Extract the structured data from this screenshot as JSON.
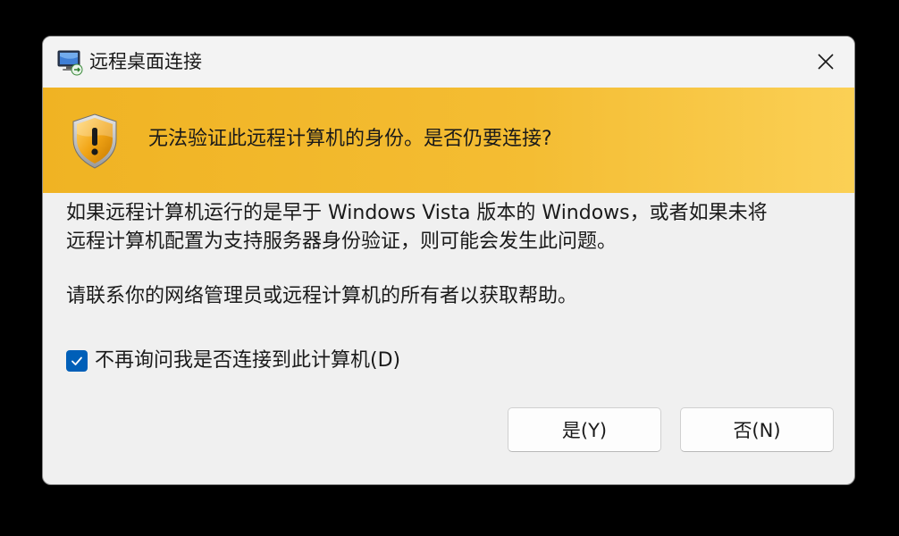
{
  "window": {
    "title": "远程桌面连接",
    "app_icon": "remote-desktop-icon",
    "close_icon": "close-icon"
  },
  "banner": {
    "icon": "warning-shield-icon",
    "message": "无法验证此远程计算机的身份。是否仍要连接?",
    "colors": {
      "start": "#f0b323",
      "end": "#fbd055"
    }
  },
  "body": {
    "paragraph1_line1": "如果远程计算机运行的是早于 Windows Vista 版本的 Windows，或者如果未将",
    "paragraph1_line2": "远程计算机配置为支持服务器身份验证，则可能会发生此问题。",
    "paragraph2": "请联系你的网络管理员或远程计算机的所有者以获取帮助。"
  },
  "checkbox": {
    "label": "不再询问我是否连接到此计算机(D)",
    "checked": true,
    "accent": "#005fb8"
  },
  "buttons": {
    "yes_label": "是(Y)",
    "no_label": "否(N)"
  }
}
